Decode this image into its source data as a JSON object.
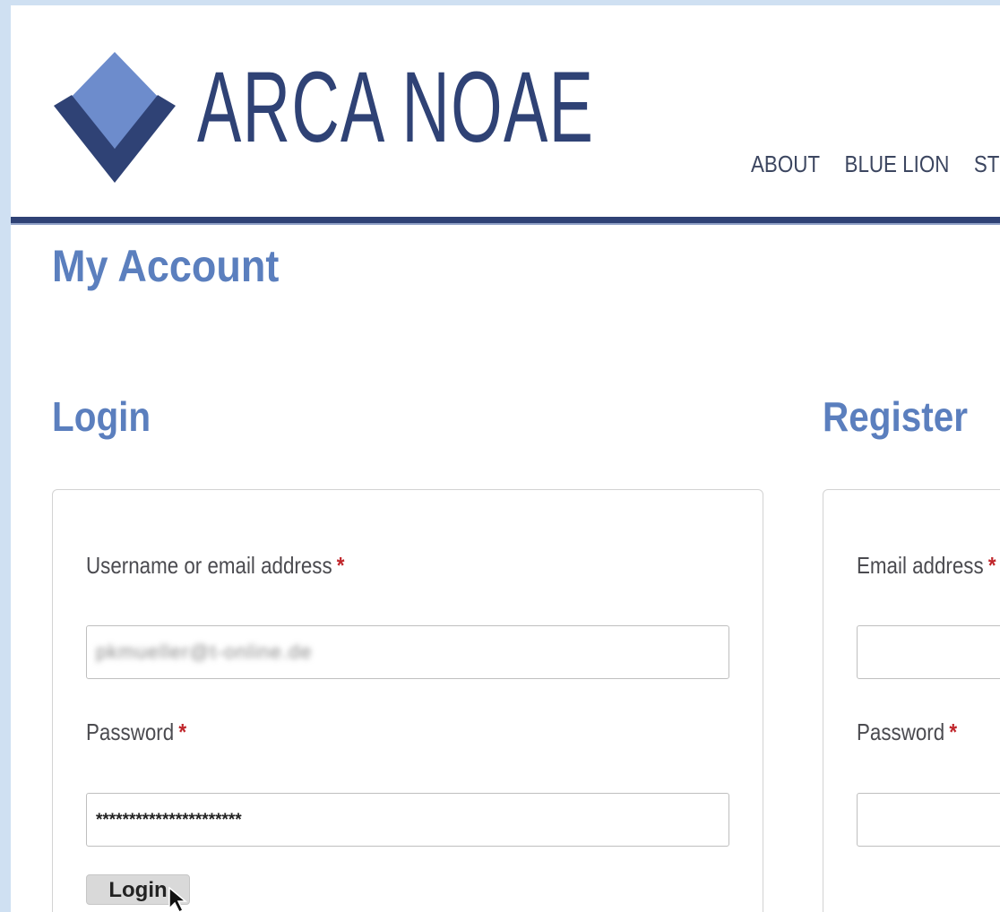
{
  "brand": {
    "name": "ARCA NOAE",
    "logo_icon": "diamond-logo-icon",
    "color": "#2f4275"
  },
  "nav": {
    "items": [
      "ABOUT",
      "BLUE LION",
      "ST"
    ]
  },
  "page": {
    "title": "My Account",
    "accent_color": "#5b7fbe"
  },
  "login": {
    "heading": "Login",
    "username_label": "Username or email address",
    "username_value": "pkmueller@t-online.de",
    "password_label": "Password",
    "password_value": "**********************",
    "required_marker": "*",
    "button_label": "Login"
  },
  "register": {
    "heading": "Register",
    "email_label": "Email address",
    "email_value": "",
    "password_label": "Password",
    "password_value": "",
    "required_marker": "*"
  },
  "cursor_icon": "mouse-pointer-icon"
}
